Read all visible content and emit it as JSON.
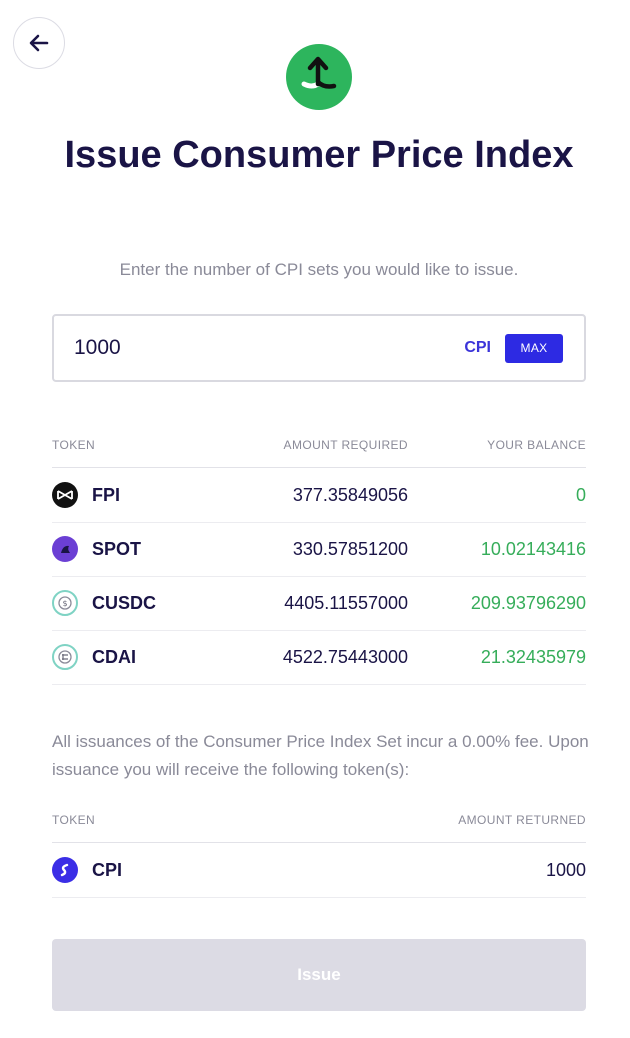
{
  "header": {
    "title": "Issue Consumer Price Index",
    "subtitle": "Enter the number of CPI sets you would like to issue."
  },
  "input": {
    "value": "1000",
    "unit": "CPI",
    "max_label": "MAX"
  },
  "required_table": {
    "columns": [
      "TOKEN",
      "AMOUNT REQUIRED",
      "YOUR BALANCE"
    ],
    "rows": [
      {
        "token": "FPI",
        "icon": "fpi-icon",
        "amount_required": "377.35849056",
        "balance": "0"
      },
      {
        "token": "SPOT",
        "icon": "spot-icon",
        "amount_required": "330.57851200",
        "balance": "10.02143416"
      },
      {
        "token": "CUSDC",
        "icon": "cusdc-icon",
        "amount_required": "4405.11557000",
        "balance": "209.93796290"
      },
      {
        "token": "CDAI",
        "icon": "cdai-icon",
        "amount_required": "4522.75443000",
        "balance": "21.32435979"
      }
    ]
  },
  "note": "All issuances of the Consumer Price Index Set incur a 0.00% fee. Upon issuance you will receive the following token(s):",
  "returned_table": {
    "columns": [
      "TOKEN",
      "AMOUNT RETURNED"
    ],
    "rows": [
      {
        "token": "CPI",
        "icon": "cpi-icon",
        "amount_returned": "1000"
      }
    ]
  },
  "actions": {
    "issue_label": "Issue"
  },
  "colors": {
    "accent": "#2d2ae3",
    "brand_green": "#2db55d",
    "balance_green": "#36ad5a",
    "heading": "#1a1446"
  }
}
